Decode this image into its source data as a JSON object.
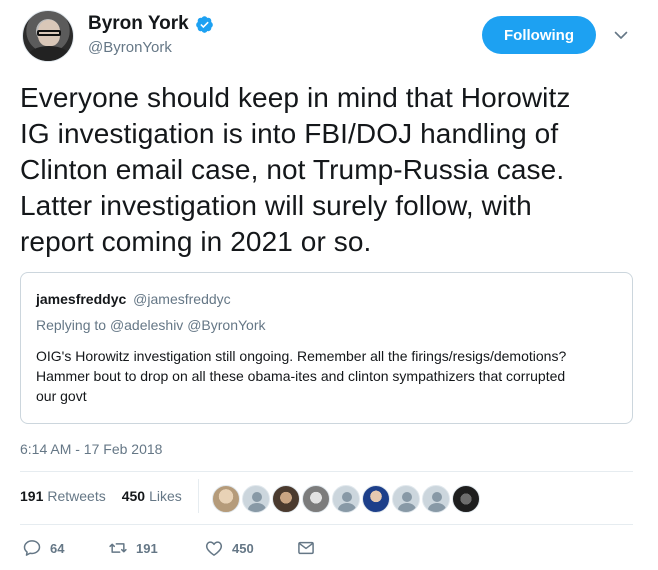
{
  "author": {
    "display_name": "Byron York",
    "handle": "@ByronYork",
    "verified": true
  },
  "follow_button": {
    "label": "Following"
  },
  "tweet": {
    "lines": [
      "Everyone should keep in mind that Horowitz",
      "IG investigation is into FBI/DOJ handling of",
      "Clinton email case, not Trump-Russia case.",
      "Latter investigation will surely follow, with",
      "report coming in 2021 or so."
    ]
  },
  "quoted_tweet": {
    "name": "jamesfreddyc",
    "handle": "@jamesfreddyc",
    "replying_prefix": "Replying to",
    "replying_to": "@adeleshiv @ByronYork",
    "body_lines": [
      "OIG's Horowitz investigation still ongoing. Remember all the firings/resigs/demotions?",
      "Hammer bout to drop on all these obama-ites and clinton sympathizers that corrupted",
      "our govt"
    ]
  },
  "timestamp": "6:14 AM - 17 Feb 2018",
  "stats": {
    "retweets_count": "191",
    "retweets_label": "Retweets",
    "likes_count": "450",
    "likes_label": "Likes"
  },
  "likers": [
    {
      "icon": "liker-avatar-1",
      "color": "#c8b49a"
    },
    {
      "icon": "default-avatar-icon",
      "color": "#ccd6dd"
    },
    {
      "icon": "liker-avatar-3",
      "color": "#6b5a4a"
    },
    {
      "icon": "liker-avatar-4",
      "color": "#9a9a9a"
    },
    {
      "icon": "default-avatar-icon",
      "color": "#ccd6dd"
    },
    {
      "icon": "liker-avatar-6",
      "color": "#1d3f8a"
    },
    {
      "icon": "default-avatar-icon",
      "color": "#ccd6dd"
    },
    {
      "icon": "default-avatar-icon",
      "color": "#ccd6dd"
    },
    {
      "icon": "liker-avatar-9",
      "color": "#2a2a2a"
    }
  ],
  "actions": {
    "reply_count": "64",
    "retweet_count": "191",
    "like_count": "450"
  },
  "colors": {
    "accent": "#1da1f2",
    "secondary_text": "#657786",
    "border": "#e6ecf0"
  }
}
